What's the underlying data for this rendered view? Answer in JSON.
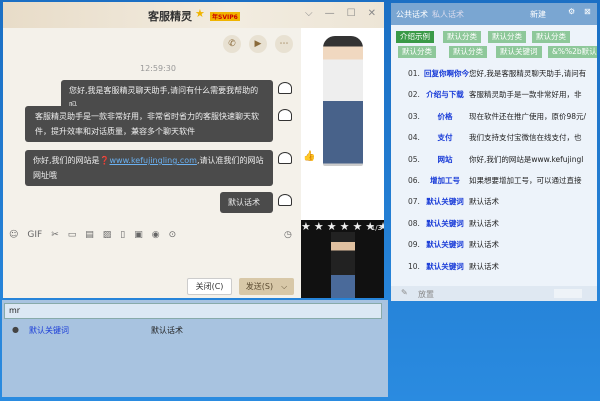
{
  "chat": {
    "title": "客服精灵",
    "vip_badge": "年SVIP6",
    "timestamp": "12:59:30",
    "messages": [
      {
        "text": "您好,我是客服精灵聊天助手,请问有什么需要我帮助的吗"
      },
      {
        "text": "客服精灵助手是一款非常好用，非常省时省力的客服快速聊天软件，提升效率和对话质量，兼容多个聊天软件"
      },
      {
        "text_before": "你好,我们的网站是",
        "link": "www.kefujingling.com",
        "text_after": ",请认准我们的网站网址哦"
      },
      {
        "text": "默认话术"
      }
    ],
    "close_label": "关闭(C)",
    "send_label": "发送(S)",
    "photo_counter": "1/3"
  },
  "search": {
    "value": "mr",
    "results": [
      {
        "keyword": "默认关键词",
        "content": "默认话术"
      }
    ]
  },
  "panel": {
    "tab_public": "公共话术",
    "tab_private": "私人话术",
    "new_label": "新建",
    "tags": [
      "介绍示例",
      "默认分类",
      "默认分类",
      "默认分类",
      "默认分类",
      "默认分类",
      "默认关键词",
      "&%%2b默认"
    ],
    "rows": [
      {
        "num": "01.",
        "kw": "回复你啊你今",
        "txt": "您好,我是客服精灵聊天助手,请问有"
      },
      {
        "num": "02.",
        "kw": "介绍与下载",
        "txt": "客服精灵助手是一款非常好用，非"
      },
      {
        "num": "03.",
        "kw": "价格",
        "txt": "现在软件还在推广使用，原价98元/"
      },
      {
        "num": "04.",
        "kw": "支付",
        "txt": "我们支持支付宝微信在线支付，也"
      },
      {
        "num": "05.",
        "kw": "网站",
        "txt": "你好,我们的网站是www.kefujingl"
      },
      {
        "num": "06.",
        "kw": "增加工号",
        "txt": "如果想要增加工号，可以通过直接"
      },
      {
        "num": "07.",
        "kw": "默认关键词",
        "txt": "默认话术"
      },
      {
        "num": "08.",
        "kw": "默认关键词",
        "txt": "默认话术"
      },
      {
        "num": "09.",
        "kw": "默认关键词",
        "txt": "默认话术"
      },
      {
        "num": "10.",
        "kw": "默认关键词",
        "txt": "默认话术"
      }
    ],
    "footer_label": "放置"
  },
  "colors": {
    "bubble": "#4b4b4b",
    "tag": "#8ec89a",
    "tag_active": "#3a9a48",
    "keyword": "#1a3cd8",
    "panel_header": "#7aa6d2"
  }
}
